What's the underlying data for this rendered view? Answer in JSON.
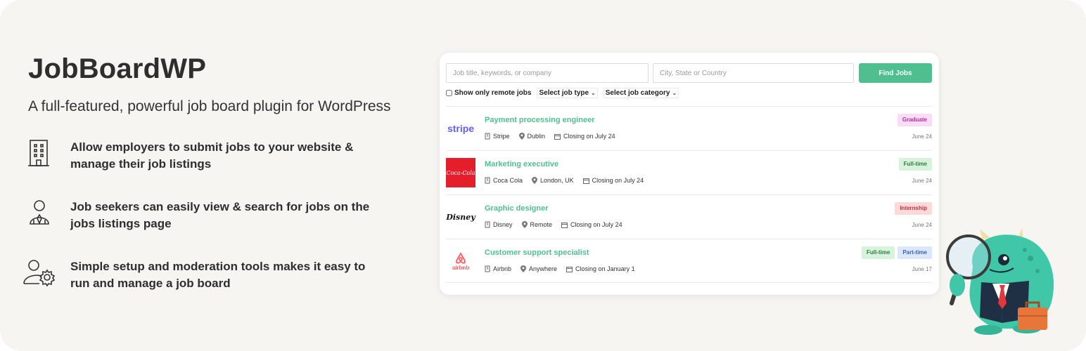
{
  "hero": {
    "title": "JobBoardWP",
    "subtitle": "A full-featured, powerful job board plugin for WordPress"
  },
  "features": [
    {
      "icon": "building-icon",
      "text": "Allow employers to submit jobs to your website & manage their job listings"
    },
    {
      "icon": "job-seeker-icon",
      "text": "Job seekers can easily view & search for jobs on the jobs listings page"
    },
    {
      "icon": "user-gear-icon",
      "text": "Simple setup and moderation tools makes it easy to run and manage a job board"
    }
  ],
  "search": {
    "keywords_placeholder": "Job title, keywords, or company",
    "location_placeholder": "City, State or Country",
    "find_label": "Find Jobs",
    "remote_label": "Show only remote jobs",
    "job_type_label": "Select job type",
    "job_category_label": "Select job category"
  },
  "jobs": [
    {
      "title": "Payment processing engineer",
      "company": "Stripe",
      "location": "Dublin",
      "closing": "Closing on July 24",
      "date": "June 24",
      "tags": [
        {
          "label": "Graduate",
          "bg": "#f9dcf5",
          "fg": "#b0329e"
        }
      ],
      "logo_text": "stripe"
    },
    {
      "title": "Marketing executive",
      "company": "Coca Cola",
      "location": "London, UK",
      "closing": "Closing on July 24",
      "date": "June 24",
      "tags": [
        {
          "label": "Full-time",
          "bg": "#d7f3dc",
          "fg": "#2f7a40"
        }
      ],
      "logo_text": "Coca-Cola"
    },
    {
      "title": "Graphic designer",
      "company": "Disney",
      "location": "Remote",
      "closing": "Closing on July 24",
      "date": "June 24",
      "tags": [
        {
          "label": "Internship",
          "bg": "#fcdada",
          "fg": "#c0323a"
        }
      ],
      "logo_text": "Disney"
    },
    {
      "title": "Customer support specialist",
      "company": "Airbnb",
      "location": "Anywhere",
      "closing": "Closing on January 1",
      "date": "June 17",
      "tags": [
        {
          "label": "Full-time",
          "bg": "#d7f3dc",
          "fg": "#2f7a40"
        },
        {
          "label": "Part-time",
          "bg": "#dbe7fb",
          "fg": "#3a63b8"
        }
      ],
      "logo_text": "airbnb"
    }
  ],
  "colors": {
    "accent": "#4fbf8f",
    "banner_bg": "#f6f5f2",
    "stripe": "#635bff",
    "coca_cola": "#e41e2b",
    "airbnb": "#ff5a5f"
  }
}
